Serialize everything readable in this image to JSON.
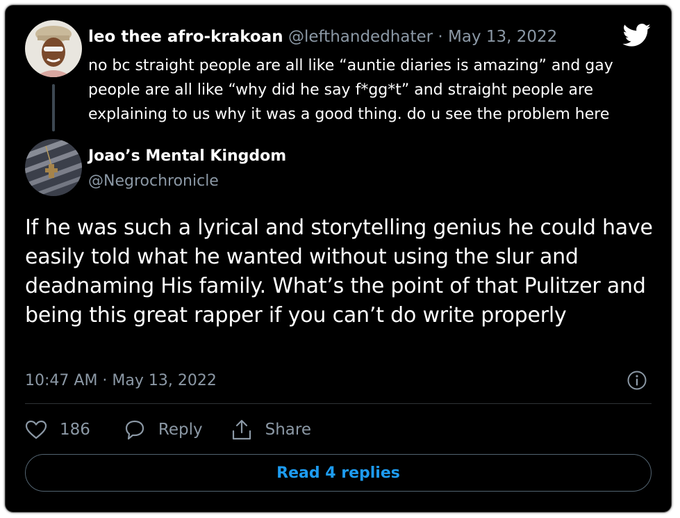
{
  "parent_tweet": {
    "author_name": "leo thee afro-krakoan",
    "handle": "@lefthandedhater",
    "separator": "·",
    "date": "May 13, 2022",
    "text": "no bc straight people are all like “auntie diaries is amazing” and gay people are all like “why did he say f*gg*t” and straight people are explaining to us why it was a good thing. do u see the problem here"
  },
  "reply_tweet": {
    "author_name": "Joao’s Mental Kingdom",
    "handle": "@Negrochronicle",
    "text": "If he was such a lyrical and storytelling genius he could have easily told what he wanted without using the slur and deadnaming His family. What’s the point of that Pulitzer and being this great rapper if you can’t do write properly",
    "timestamp": "10:47 AM · May 13, 2022"
  },
  "actions": {
    "like_count": "186",
    "reply_label": "Reply",
    "share_label": "Share"
  },
  "read_replies_label": "Read 4 replies",
  "colors": {
    "background": "#000000",
    "text": "#ffffff",
    "muted": "#8b98a5",
    "accent": "#1d9bf0",
    "border": "#536471"
  },
  "icons": [
    "twitter-bird-icon",
    "info-icon",
    "heart-icon",
    "speech-bubble-icon",
    "share-icon"
  ]
}
